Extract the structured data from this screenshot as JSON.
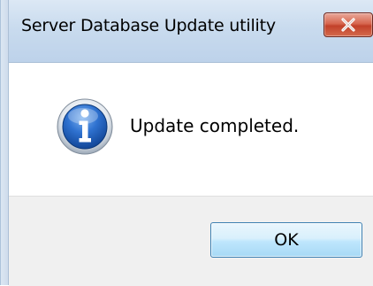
{
  "window": {
    "title": "Server Database Update utility",
    "close_icon": "close-icon"
  },
  "dialog": {
    "icon": "info-icon",
    "message": "Update completed."
  },
  "buttons": {
    "ok_label": "OK"
  },
  "colors": {
    "title_bar": "#c9dbee",
    "close_button": "#c2412a",
    "button_bar": "#f0f0f0",
    "ok_button_border": "#3c7fb1",
    "info_icon_blue": "#1f5fb8"
  }
}
